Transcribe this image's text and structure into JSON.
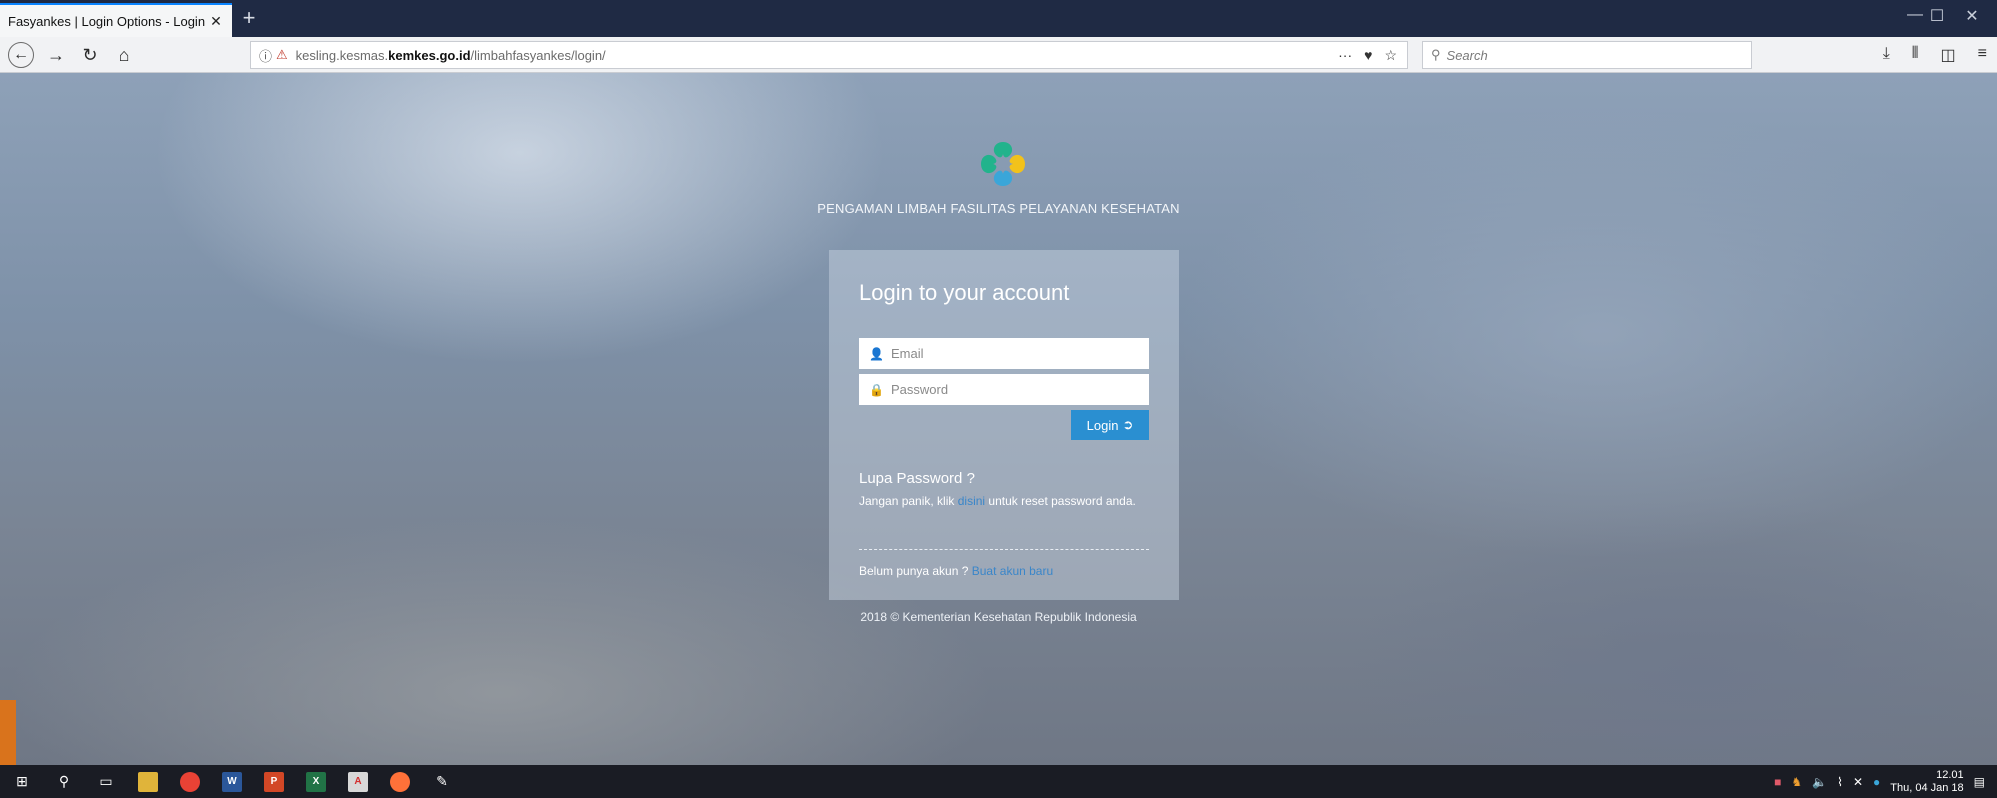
{
  "browser": {
    "tab_title": "Fasyankes | Login Options - Login f",
    "tab_close": "✕",
    "new_tab": "+",
    "url": {
      "prefix": "kesling.kesmas.",
      "domain": "kemkes.go.id",
      "path": "/limbahfasyankes/login/"
    },
    "url_actions": [
      "···",
      "♥",
      "☆"
    ],
    "search_placeholder": "Search",
    "window_controls": [
      "—",
      "☐",
      "✕"
    ]
  },
  "page": {
    "app_title": "PENGAMAN LIMBAH FASILITAS PELAYANAN KESEHATAN",
    "login": {
      "heading": "Login to your account",
      "email_placeholder": "Email",
      "password_placeholder": "Password",
      "login_button": "Login",
      "forgot_title": "Lupa Password ?",
      "forgot_text_before": "Jangan panik, klik ",
      "forgot_link": "disini",
      "forgot_text_after": " untuk reset password anda.",
      "register_text": "Belum punya akun ? ",
      "register_link": "Buat akun baru"
    },
    "footer": "2018 © Kementerian Kesehatan Republik Indonesia"
  },
  "taskbar": {
    "time": "12.01",
    "date": "Thu, 04 Jan 18"
  },
  "colors": {
    "accent": "#2a8fd1",
    "logo_green": "#22b38c",
    "logo_blue": "#3aa6d9",
    "logo_yellow": "#f2c21b",
    "link": "#3a86c9"
  }
}
